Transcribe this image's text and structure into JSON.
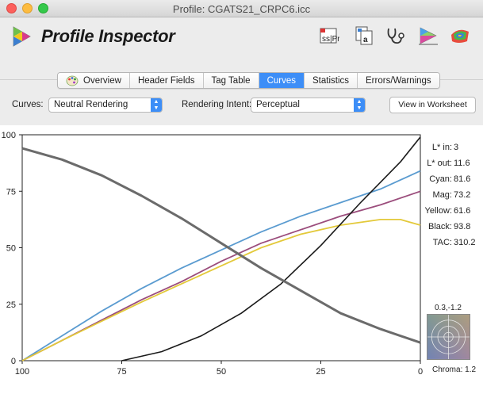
{
  "window": {
    "title": "Profile: CGATS21_CRPC6.icc"
  },
  "app": {
    "name": "Profile Inspector"
  },
  "toolbar": {
    "icons": [
      "profile-info-icon",
      "document-stack-icon",
      "stethoscope-icon",
      "color-gamut-icon",
      "color-swatches-icon"
    ]
  },
  "tabs": [
    {
      "label": "Overview",
      "active": false
    },
    {
      "label": "Header Fields",
      "active": false
    },
    {
      "label": "Tag Table",
      "active": false
    },
    {
      "label": "Curves",
      "active": true
    },
    {
      "label": "Statistics",
      "active": false
    },
    {
      "label": "Errors/Warnings",
      "active": false
    }
  ],
  "controls": {
    "curves_label": "Curves:",
    "curves_value": "Neutral Rendering",
    "intent_label": "Rendering Intent:",
    "intent_value": "Perceptual",
    "worksheet_button": "View in Worksheet"
  },
  "readouts": [
    {
      "label": "L* in:",
      "value": "3"
    },
    {
      "label": "L* out:",
      "value": "11.6"
    },
    {
      "label": "Cyan:",
      "value": "81.6"
    },
    {
      "label": "Mag:",
      "value": "73.2"
    },
    {
      "label": "Yellow:",
      "value": "61.6"
    },
    {
      "label": "Black:",
      "value": "93.8"
    },
    {
      "label": "TAC:",
      "value": "310.2"
    }
  ],
  "chroma": {
    "coord": "0.3,-1.2",
    "label": "Chroma:",
    "value": "1.2"
  },
  "chart_data": {
    "type": "line",
    "xlabel": "",
    "ylabel": "",
    "xlim": [
      100,
      0
    ],
    "ylim": [
      0,
      100
    ],
    "x_ticks": [
      "100",
      "75",
      "50",
      "25",
      "0"
    ],
    "y_ticks": [
      "100",
      "75",
      "50",
      "25",
      "0"
    ],
    "grid": false,
    "series": [
      {
        "color": "#5a9bd0",
        "x": [
          100,
          90,
          80,
          70,
          60,
          50,
          40,
          30,
          20,
          10,
          0
        ],
        "y": [
          0,
          11,
          22,
          32,
          41,
          49,
          57,
          64,
          70,
          76,
          84
        ]
      },
      {
        "color": "#9b4d7c",
        "x": [
          100,
          90,
          80,
          70,
          60,
          50,
          40,
          30,
          20,
          10,
          0
        ],
        "y": [
          0,
          9,
          18,
          27,
          35,
          44,
          52,
          58,
          64,
          69,
          75
        ]
      },
      {
        "color": "#e3c93a",
        "x": [
          100,
          90,
          80,
          70,
          60,
          50,
          40,
          30,
          20,
          10,
          5,
          0
        ],
        "y": [
          0,
          9,
          17.5,
          26,
          34,
          42,
          50,
          56,
          60,
          62.5,
          62.5,
          60
        ]
      },
      {
        "color": "#1a1a1a",
        "x": [
          75,
          65,
          55,
          45,
          35,
          25,
          15,
          5,
          0
        ],
        "y": [
          0,
          4,
          11,
          21,
          34,
          51,
          70,
          88,
          99
        ]
      },
      {
        "color": "#6b6b6b",
        "x": [
          100,
          90,
          80,
          70,
          60,
          50,
          40,
          30,
          20,
          10,
          0
        ],
        "y": [
          94,
          89,
          82,
          73,
          63,
          52,
          41,
          31,
          21,
          14,
          8
        ]
      }
    ]
  }
}
